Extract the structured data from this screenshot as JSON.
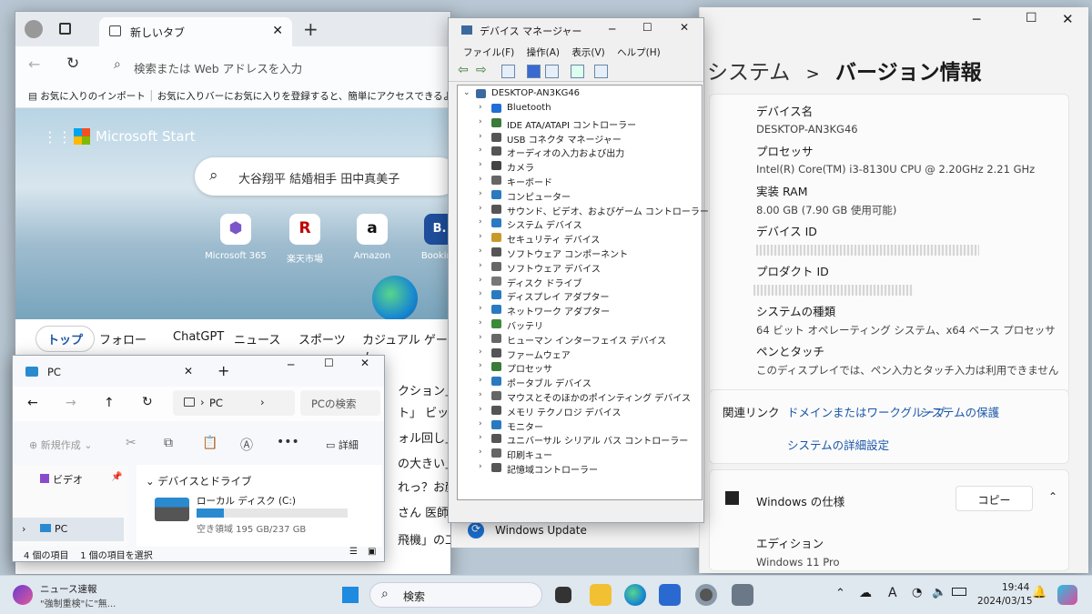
{
  "edge": {
    "tab_title": "新しいタブ",
    "address_placeholder": "検索または Web アドレスを入力",
    "fav_import": "お気に入りのインポート",
    "fav_hint": "お気に入りバーにお気に入りを登録すると、簡単にアクセスできるようになります。",
    "start_label": "Microsoft Start",
    "search_text": "大谷翔平 結婚相手 田中真美子",
    "apps": [
      {
        "label": "Microsoft 365",
        "glyph": "⬢",
        "color": "#7b56c8"
      },
      {
        "label": "楽天市場",
        "glyph": "R",
        "color": "#bf0000"
      },
      {
        "label": "Amazon",
        "glyph": "a",
        "color": "#111"
      },
      {
        "label": "Booking",
        "glyph": "B.",
        "color": "#1e4e9c"
      }
    ],
    "nav": [
      "トップ",
      "フォロー",
      "ChatGPT",
      "ニュース",
      "スポーツ",
      "カジュアル ゲーム"
    ],
    "news_fragments": [
      "クション」",
      "ト」 ビッ",
      "ォル回し」",
      "の大きい」 戦",
      "れっ？お顔",
      "さん 医師",
      "飛機」の工場"
    ]
  },
  "devmgr": {
    "title": "デバイス マネージャー",
    "menu": [
      "ファイル(F)",
      "操作(A)",
      "表示(V)",
      "ヘルプ(H)"
    ],
    "root": "DESKTOP-AN3KG46",
    "items": [
      {
        "label": "Bluetooth",
        "color": "#1f6fd6"
      },
      {
        "label": "IDE ATA/ATAPI コントローラー",
        "color": "#3a7a3a"
      },
      {
        "label": "USB コネクタ マネージャー",
        "color": "#555"
      },
      {
        "label": "オーディオの入力および出力",
        "color": "#555"
      },
      {
        "label": "カメラ",
        "color": "#444"
      },
      {
        "label": "キーボード",
        "color": "#666"
      },
      {
        "label": "コンピューター",
        "color": "#2a7ac0"
      },
      {
        "label": "サウンド、ビデオ、およびゲーム コントローラー",
        "color": "#555"
      },
      {
        "label": "システム デバイス",
        "color": "#2a7ac0"
      },
      {
        "label": "セキュリティ デバイス",
        "color": "#c89a2a"
      },
      {
        "label": "ソフトウェア コンポーネント",
        "color": "#555"
      },
      {
        "label": "ソフトウェア デバイス",
        "color": "#666"
      },
      {
        "label": "ディスク ドライブ",
        "color": "#777"
      },
      {
        "label": "ディスプレイ アダプター",
        "color": "#2a7ac0"
      },
      {
        "label": "ネットワーク アダプター",
        "color": "#2a7ac0"
      },
      {
        "label": "バッテリ",
        "color": "#3a8a3a"
      },
      {
        "label": "ヒューマン インターフェイス デバイス",
        "color": "#666"
      },
      {
        "label": "ファームウェア",
        "color": "#555"
      },
      {
        "label": "プロセッサ",
        "color": "#3a7a3a"
      },
      {
        "label": "ポータブル デバイス",
        "color": "#2a7ac0"
      },
      {
        "label": "マウスとそのほかのポインティング デバイス",
        "color": "#666"
      },
      {
        "label": "メモリ テクノロジ デバイス",
        "color": "#555"
      },
      {
        "label": "モニター",
        "color": "#2a7ac0"
      },
      {
        "label": "ユニバーサル シリアル バス コントローラー",
        "color": "#555"
      },
      {
        "label": "印刷キュー",
        "color": "#666"
      },
      {
        "label": "記憶域コントローラー",
        "color": "#555"
      }
    ]
  },
  "settings": {
    "breadcrumb_parent": "システム",
    "breadcrumb_sep": ">",
    "title": "バージョン情報",
    "specs": [
      {
        "label": "デバイス名",
        "value": "DESKTOP-AN3KG46"
      },
      {
        "label": "プロセッサ",
        "value": "Intel(R) Core(TM) i3-8130U CPU @ 2.20GHz   2.21 GHz"
      },
      {
        "label": "実装 RAM",
        "value": "8.00 GB (7.90 GB 使用可能)"
      },
      {
        "label": "デバイス ID",
        "value": ""
      },
      {
        "label": "プロダクト ID",
        "value": ""
      },
      {
        "label": "システムの種類",
        "value": "64 ビット オペレーティング システム、x64 ベース プロセッサ"
      },
      {
        "label": "ペンとタッチ",
        "value": "このディスプレイでは、ペン入力とタッチ入力は利用できません"
      }
    ],
    "related_label": "関連リンク",
    "link_domain": "ドメインまたはワークグループ",
    "link_protect": "システムの保護",
    "link_advanced": "システムの詳細設定",
    "windows_spec": "Windows の仕様",
    "copy_label": "コピー",
    "edition_label": "エディション",
    "edition_value": "Windows 11 Pro",
    "windows_update": "Windows Update"
  },
  "explorer": {
    "tab_title": "PC",
    "path": "PC",
    "search_placeholder": "PCの検索",
    "new_label": "新規作成",
    "details_label": "詳細",
    "side_video": "ビデオ",
    "side_pc": "PC",
    "section": "デバイスとドライブ",
    "drive_name": "ローカル ディスク (C:)",
    "drive_free": "空き領域 195 GB/237 GB",
    "drive_used_fraction": 0.18,
    "status_count": "4 個の項目",
    "status_selected": "1 個の項目を選択"
  },
  "taskbar": {
    "news_title": "ニュース速報",
    "news_sub": "\"強制重検\"に\"無...",
    "search_label": "検索",
    "ime": "A",
    "time": "19:44",
    "date": "2024/03/15"
  }
}
